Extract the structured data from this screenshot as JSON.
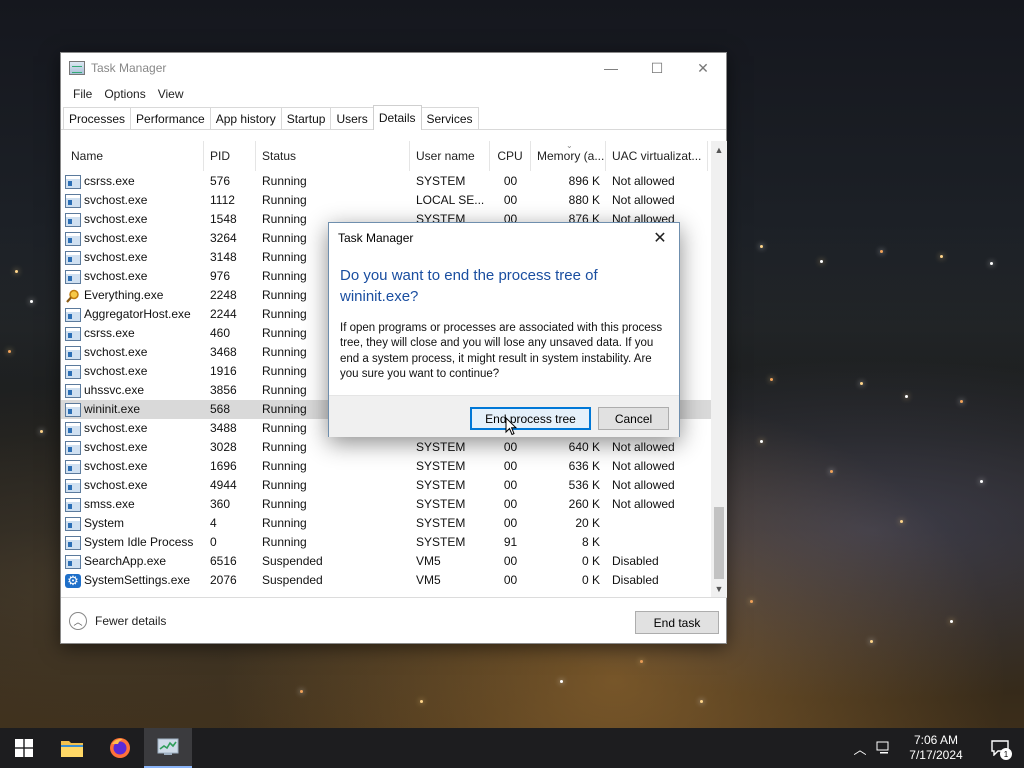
{
  "window": {
    "title": "Task Manager",
    "minimize_glyph": "—",
    "maximize_glyph": "☐",
    "close_glyph": "✕"
  },
  "menu": [
    "File",
    "Options",
    "View"
  ],
  "tabs": [
    "Processes",
    "Performance",
    "App history",
    "Startup",
    "Users",
    "Details",
    "Services"
  ],
  "active_tab": "Details",
  "columns": {
    "name": "Name",
    "pid": "PID",
    "status": "Status",
    "user": "User name",
    "cpu": "CPU",
    "memory": "Memory (a...",
    "uac": "UAC virtualizat..."
  },
  "rows": [
    {
      "name": "csrss.exe",
      "pid": "576",
      "status": "Running",
      "user": "SYSTEM",
      "cpu": "00",
      "mem": "896 K",
      "uac": "Not allowed",
      "icon": "process-icon"
    },
    {
      "name": "svchost.exe",
      "pid": "1112",
      "status": "Running",
      "user": "LOCAL SE...",
      "cpu": "00",
      "mem": "880 K",
      "uac": "Not allowed",
      "icon": "process-icon"
    },
    {
      "name": "svchost.exe",
      "pid": "1548",
      "status": "Running",
      "user": "SYSTEM",
      "cpu": "00",
      "mem": "876 K",
      "uac": "Not allowed",
      "icon": "process-icon"
    },
    {
      "name": "svchost.exe",
      "pid": "3264",
      "status": "Running",
      "user": "",
      "cpu": "",
      "mem": "",
      "uac": "",
      "icon": "process-icon"
    },
    {
      "name": "svchost.exe",
      "pid": "3148",
      "status": "Running",
      "user": "",
      "cpu": "",
      "mem": "",
      "uac": "",
      "icon": "process-icon"
    },
    {
      "name": "svchost.exe",
      "pid": "976",
      "status": "Running",
      "user": "",
      "cpu": "",
      "mem": "",
      "uac": "",
      "icon": "process-icon"
    },
    {
      "name": "Everything.exe",
      "pid": "2248",
      "status": "Running",
      "user": "",
      "cpu": "",
      "mem": "",
      "uac": "",
      "icon": "magnifier-icon"
    },
    {
      "name": "AggregatorHost.exe",
      "pid": "2244",
      "status": "Running",
      "user": "",
      "cpu": "",
      "mem": "",
      "uac": "",
      "icon": "process-icon"
    },
    {
      "name": "csrss.exe",
      "pid": "460",
      "status": "Running",
      "user": "",
      "cpu": "",
      "mem": "",
      "uac": "",
      "icon": "process-icon"
    },
    {
      "name": "svchost.exe",
      "pid": "3468",
      "status": "Running",
      "user": "",
      "cpu": "",
      "mem": "",
      "uac": "",
      "icon": "process-icon"
    },
    {
      "name": "svchost.exe",
      "pid": "1916",
      "status": "Running",
      "user": "",
      "cpu": "",
      "mem": "",
      "uac": "",
      "icon": "process-icon"
    },
    {
      "name": "uhssvc.exe",
      "pid": "3856",
      "status": "Running",
      "user": "",
      "cpu": "",
      "mem": "",
      "uac": "",
      "icon": "process-icon"
    },
    {
      "name": "wininit.exe",
      "pid": "568",
      "status": "Running",
      "user": "",
      "cpu": "",
      "mem": "",
      "uac": "",
      "icon": "process-icon",
      "selected": true
    },
    {
      "name": "svchost.exe",
      "pid": "3488",
      "status": "Running",
      "user": "",
      "cpu": "",
      "mem": "",
      "uac": "",
      "icon": "process-icon"
    },
    {
      "name": "svchost.exe",
      "pid": "3028",
      "status": "Running",
      "user": "SYSTEM",
      "cpu": "00",
      "mem": "640 K",
      "uac": "Not allowed",
      "icon": "process-icon"
    },
    {
      "name": "svchost.exe",
      "pid": "1696",
      "status": "Running",
      "user": "SYSTEM",
      "cpu": "00",
      "mem": "636 K",
      "uac": "Not allowed",
      "icon": "process-icon"
    },
    {
      "name": "svchost.exe",
      "pid": "4944",
      "status": "Running",
      "user": "SYSTEM",
      "cpu": "00",
      "mem": "536 K",
      "uac": "Not allowed",
      "icon": "process-icon"
    },
    {
      "name": "smss.exe",
      "pid": "360",
      "status": "Running",
      "user": "SYSTEM",
      "cpu": "00",
      "mem": "260 K",
      "uac": "Not allowed",
      "icon": "process-icon"
    },
    {
      "name": "System",
      "pid": "4",
      "status": "Running",
      "user": "SYSTEM",
      "cpu": "00",
      "mem": "20 K",
      "uac": "",
      "icon": "process-icon"
    },
    {
      "name": "System Idle Process",
      "pid": "0",
      "status": "Running",
      "user": "SYSTEM",
      "cpu": "91",
      "mem": "8 K",
      "uac": "",
      "icon": "process-icon"
    },
    {
      "name": "SearchApp.exe",
      "pid": "6516",
      "status": "Suspended",
      "user": "VM5",
      "cpu": "00",
      "mem": "0 K",
      "uac": "Disabled",
      "icon": "process-icon"
    },
    {
      "name": "SystemSettings.exe",
      "pid": "2076",
      "status": "Suspended",
      "user": "VM5",
      "cpu": "00",
      "mem": "0 K",
      "uac": "Disabled",
      "icon": "gear-icon"
    }
  ],
  "footer": {
    "fewer_details": "Fewer details",
    "end_task": "End task"
  },
  "dialog": {
    "title": "Task Manager",
    "heading": "Do you want to end the process tree of wininit.exe?",
    "body": "If open programs or processes are associated with this process tree, they will close and you will lose any unsaved data. If you end a system process, it might result in system instability. Are you sure you want to continue?",
    "confirm_button": "End process tree",
    "cancel_button": "Cancel"
  },
  "taskbar": {
    "time": "7:06 AM",
    "date": "7/17/2024",
    "notification_count": "1"
  },
  "colors": {
    "dialog_heading": "#1a4ea0",
    "primary_button_border": "#0078d7",
    "selected_row": "#d9d9d9",
    "taskbar": "#1d1d1f"
  }
}
